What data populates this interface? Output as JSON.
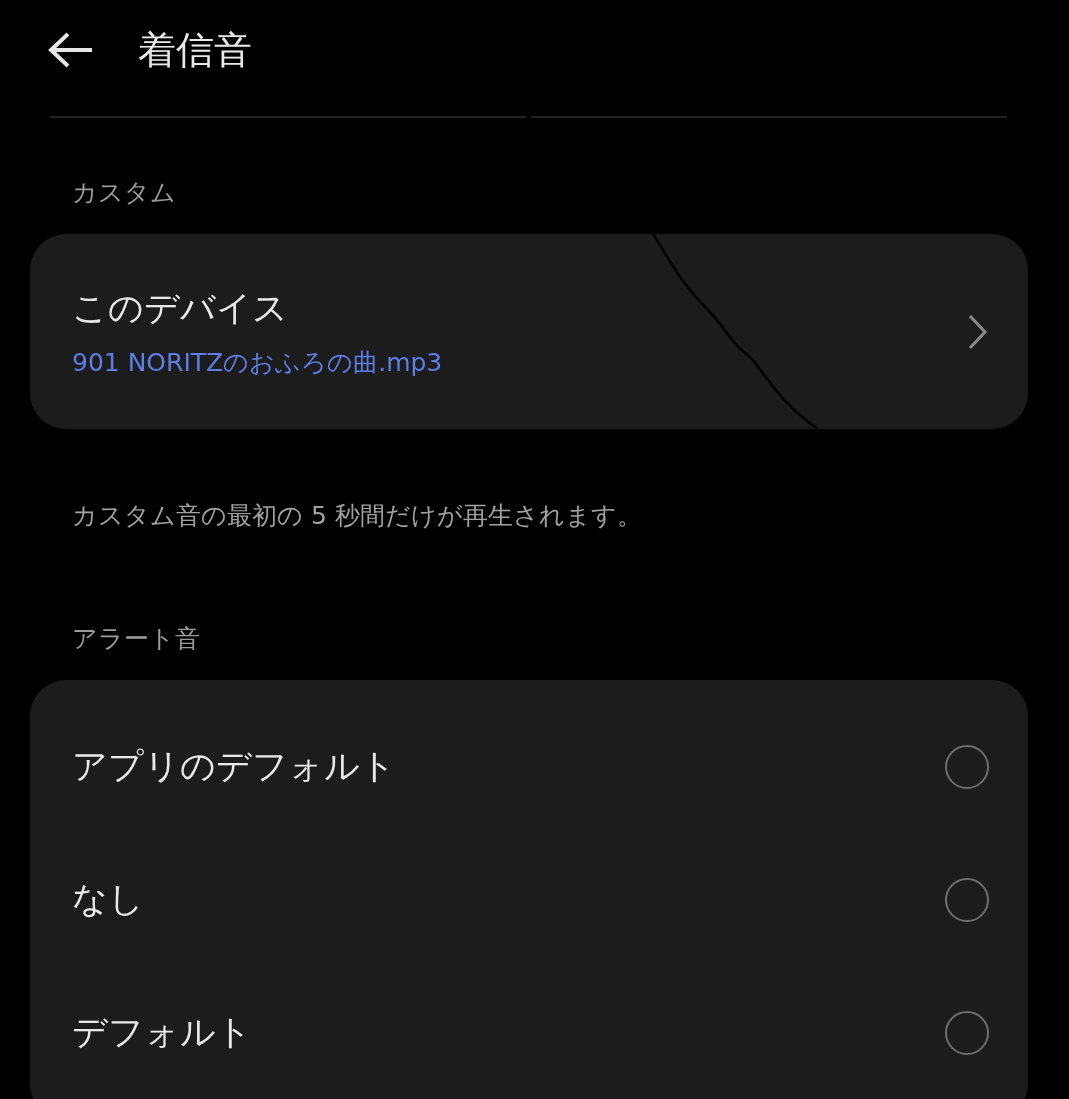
{
  "header": {
    "title": "着信音"
  },
  "custom": {
    "label": "カスタム",
    "item": {
      "title": "このデバイス",
      "subtitle": "901 NORITZのおふろの曲.mp3"
    },
    "note": "カスタム音の最初の 5 秒間だけが再生されます。"
  },
  "alert": {
    "label": "アラート音",
    "options": [
      {
        "label": "アプリのデフォルト",
        "selected": false
      },
      {
        "label": "なし",
        "selected": false
      },
      {
        "label": "デフォルト",
        "selected": false
      }
    ]
  }
}
